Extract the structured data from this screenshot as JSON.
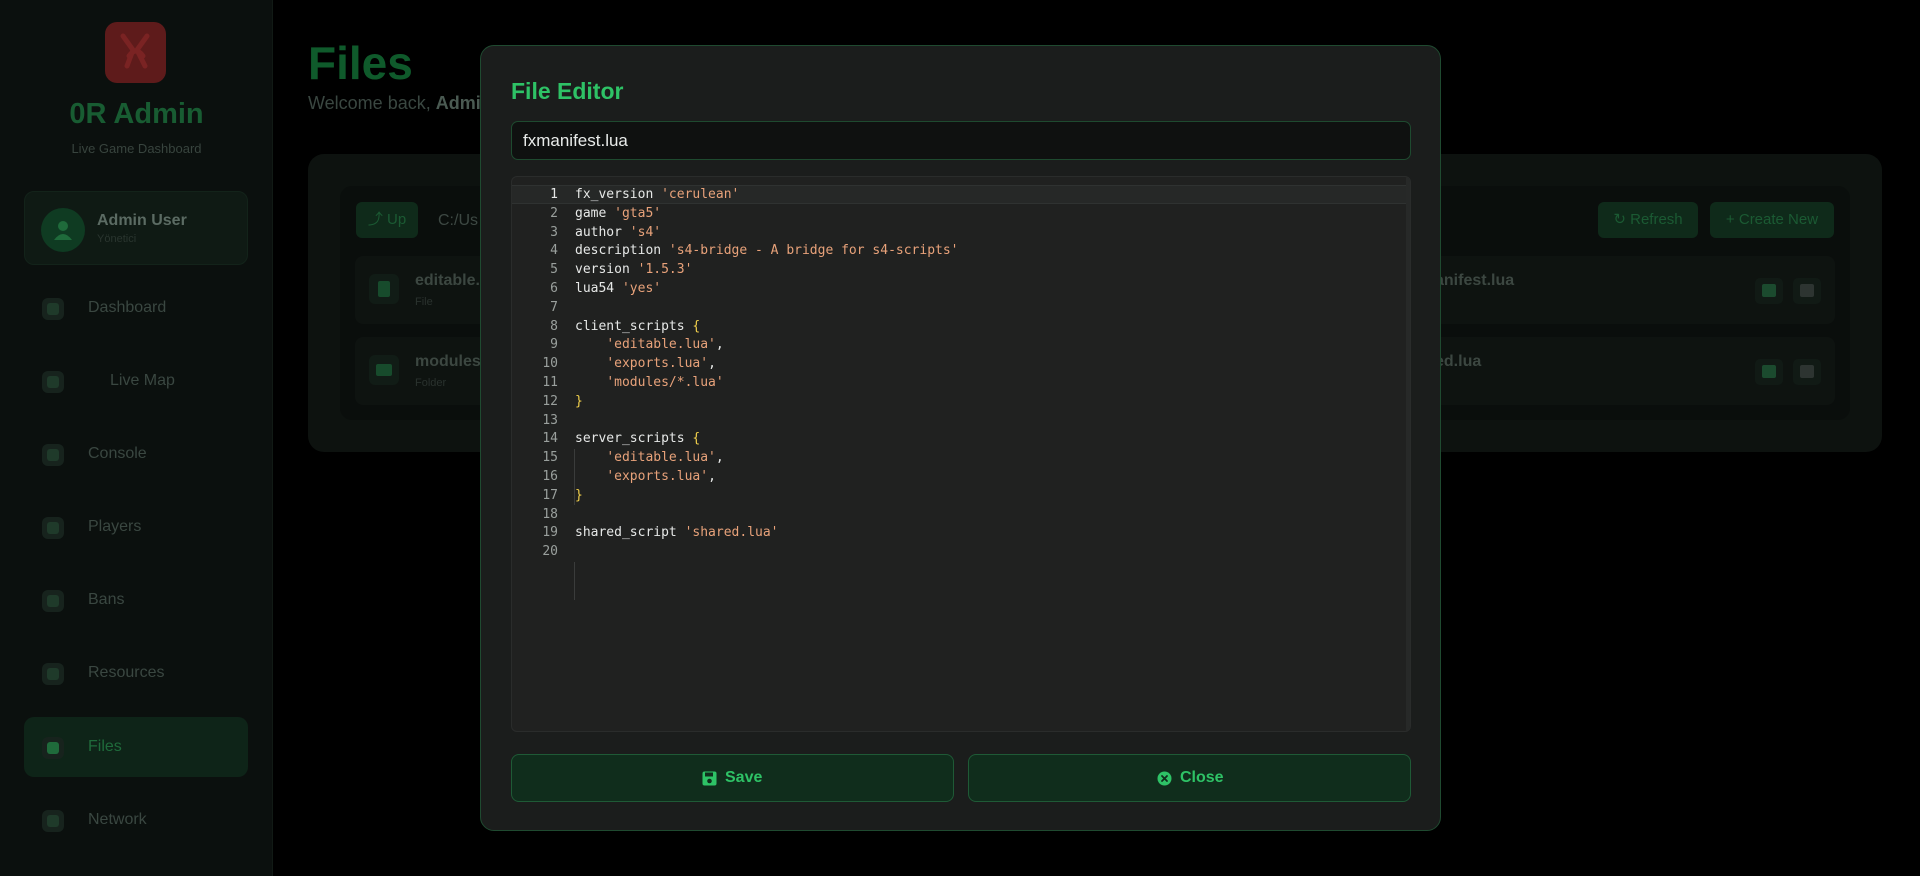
{
  "sidebar": {
    "brand": "0R Admin",
    "subtitle": "Live Game Dashboard",
    "user": {
      "name": "Admin User",
      "role": "Yönetici"
    },
    "items": [
      {
        "label": "Dashboard",
        "icon": "dashboard-icon"
      },
      {
        "label": "Live Map",
        "icon": "map-icon"
      },
      {
        "label": "Console",
        "icon": "terminal-icon"
      },
      {
        "label": "Players",
        "icon": "users-icon"
      },
      {
        "label": "Bans",
        "icon": "ban-icon"
      },
      {
        "label": "Resources",
        "icon": "cubes-icon"
      },
      {
        "label": "Files",
        "icon": "folder-open-icon",
        "active": true
      },
      {
        "label": "Network",
        "icon": "network-icon"
      }
    ]
  },
  "page": {
    "title": "Files",
    "welcome_prefix": "Welcome back, ",
    "welcome_name": "Admi"
  },
  "browser": {
    "up_label": "Up",
    "path": "C:/Us",
    "refresh_label": "Refresh",
    "create_label": "Create New",
    "rows": [
      {
        "name": "editable.",
        "type": "File",
        "right_name": "anifest.lua"
      },
      {
        "name": "modules",
        "type": "Folder",
        "right_name": "ed.lua"
      }
    ]
  },
  "modal": {
    "title": "File Editor",
    "filename": "fxmanifest.lua",
    "save_label": "Save",
    "close_label": "Close",
    "line_numbers": [
      "1",
      "2",
      "3",
      "4",
      "5",
      "6",
      "7",
      "8",
      "9",
      "10",
      "11",
      "12",
      "13",
      "14",
      "15",
      "16",
      "17",
      "18",
      "19",
      "20"
    ],
    "code_lines": [
      "fx_version 'cerulean'",
      "game 'gta5'",
      "author 's4'",
      "description 's4-bridge - A bridge for s4-scripts'",
      "version '1.5.3'",
      "lua54 'yes'",
      "",
      "client_scripts {",
      "    'editable.lua',",
      "    'exports.lua',",
      "    'modules/*.lua'",
      "}",
      "",
      "server_scripts {",
      "    'editable.lua',",
      "    'exports.lua',",
      "}",
      "",
      "shared_script 'shared.lua'",
      ""
    ]
  },
  "colors": {
    "accent": "#2ec266",
    "string": "#e8a27a",
    "brace": "#f1d04b",
    "modal_bg": "#1b1d1c"
  }
}
